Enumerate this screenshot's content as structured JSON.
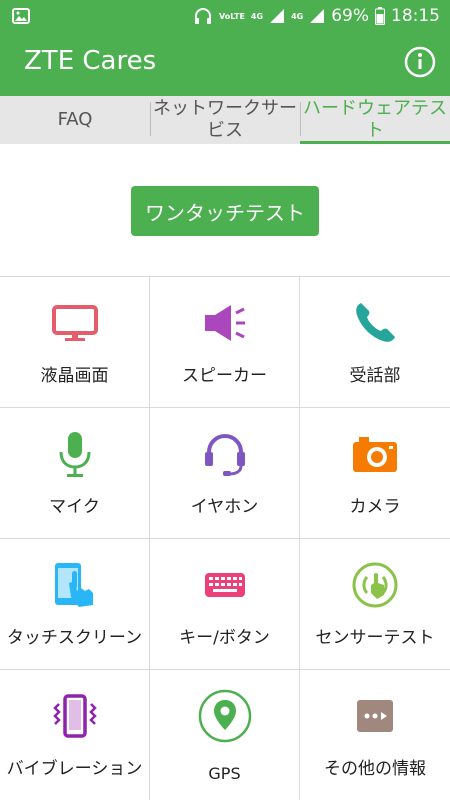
{
  "status": {
    "battery": "69%",
    "time": "18:15",
    "volte": "VoLTE",
    "net1": "4G",
    "net2": "4G"
  },
  "app": {
    "title": "ZTE Cares"
  },
  "tabs": [
    {
      "label": "FAQ"
    },
    {
      "label": "ネットワークサービス"
    },
    {
      "label": "ハードウェアテスト"
    }
  ],
  "main": {
    "one_touch_label": "ワンタッチテスト"
  },
  "grid": [
    {
      "label": "液晶画面",
      "icon": "monitor-icon"
    },
    {
      "label": "スピーカー",
      "icon": "speaker-icon"
    },
    {
      "label": "受話部",
      "icon": "phone-icon"
    },
    {
      "label": "マイク",
      "icon": "microphone-icon"
    },
    {
      "label": "イヤホン",
      "icon": "headset-icon"
    },
    {
      "label": "カメラ",
      "icon": "camera-icon"
    },
    {
      "label": "タッチスクリーン",
      "icon": "touchscreen-icon"
    },
    {
      "label": "キー/ボタン",
      "icon": "keyboard-icon"
    },
    {
      "label": "センサーテスト",
      "icon": "sensor-icon"
    },
    {
      "label": "バイブレーション",
      "icon": "vibration-icon"
    },
    {
      "label": "GPS",
      "icon": "gps-pin-icon"
    },
    {
      "label": "その他の情報",
      "icon": "more-info-icon"
    }
  ],
  "colors": {
    "primary": "#4caf50",
    "monitor": "#e35d6a",
    "speaker": "#ab47bc",
    "phone": "#26a69a",
    "mic": "#4caf50",
    "headset": "#7e57c2",
    "camera": "#f57c00",
    "touch": "#29b6f6",
    "keyboard": "#ec407a",
    "sensor": "#8bc34a",
    "vibration": "#8e24aa",
    "more": "#a1887f"
  }
}
